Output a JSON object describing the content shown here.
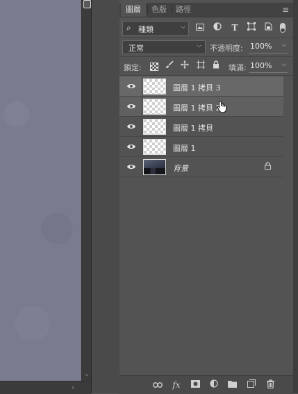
{
  "tabs": [
    {
      "label": "圖層"
    },
    {
      "label": "色版"
    },
    {
      "label": "路徑"
    }
  ],
  "filter": {
    "kind_label": "種類",
    "icons": [
      "image-filter-icon",
      "adjustment-filter-icon",
      "type-filter-icon",
      "shape-filter-icon",
      "smart-object-filter-icon"
    ],
    "type_glyph": "T"
  },
  "blend": {
    "mode": "正常",
    "opacity_label": "不透明度:",
    "opacity_value": "100%"
  },
  "lock": {
    "label": "鎖定:",
    "fill_label": "填滿:",
    "fill_value": "100%"
  },
  "layers": [
    {
      "name": "圖層 1 拷貝 3",
      "state": "selected",
      "thumb": "transparent"
    },
    {
      "name": "圖層 1 拷貝 2",
      "state": "hover",
      "thumb": "transparent"
    },
    {
      "name": "圖層 1 拷貝",
      "state": "normal",
      "thumb": "transparent"
    },
    {
      "name": "圖層 1",
      "state": "normal",
      "thumb": "transparent"
    },
    {
      "name": "背景",
      "state": "normal",
      "thumb": "photo",
      "locked": true
    }
  ],
  "bottom_bar": {
    "fx_label": "fx",
    "icons": [
      "link-layers-icon",
      "fx-icon",
      "add-mask-icon",
      "adjustment-layer-icon",
      "new-group-icon",
      "new-layer-icon",
      "delete-layer-icon"
    ]
  },
  "colors": {
    "panel_bg": "#535353",
    "selected_row": "#686868",
    "canvas": "#7a7b8f"
  }
}
